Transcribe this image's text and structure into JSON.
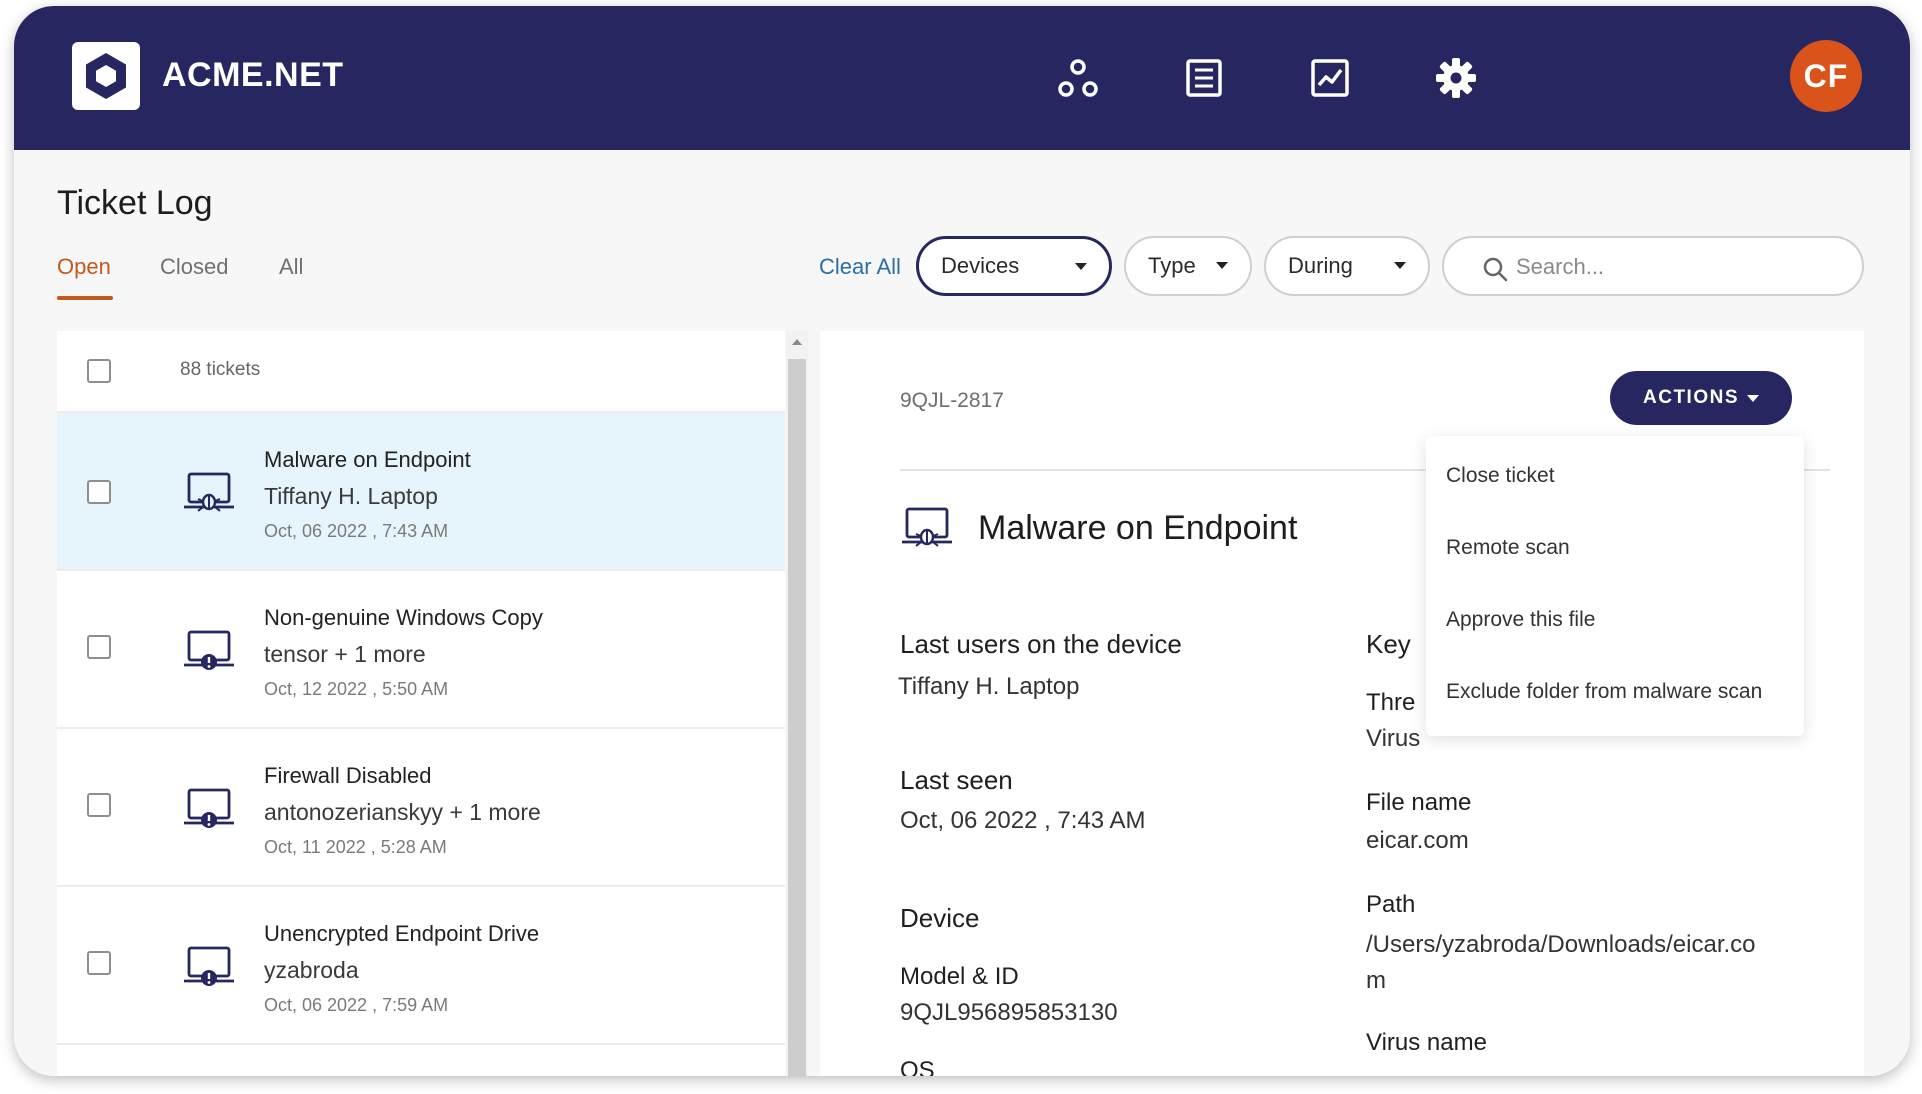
{
  "header": {
    "brand": "ACME.NET",
    "avatar_initials": "CF",
    "icons": [
      "network-icon",
      "list-icon",
      "chart-icon",
      "gear-icon"
    ]
  },
  "page": {
    "title": "Ticket Log",
    "tabs": [
      {
        "label": "Open",
        "active": true
      },
      {
        "label": "Closed",
        "active": false
      },
      {
        "label": "All",
        "active": false
      }
    ]
  },
  "filters": {
    "clear_all": "Clear All",
    "devices": "Devices",
    "type": "Type",
    "during": "During",
    "search_placeholder": "Search..."
  },
  "list": {
    "count": "88 tickets",
    "tickets": [
      {
        "title": "Malware on Endpoint",
        "subtitle": "Tiffany H. Laptop",
        "date": "Oct, 06 2022 , 7:43 AM",
        "icon": "malware-laptop-icon",
        "selected": true
      },
      {
        "title": "Non-genuine Windows Copy",
        "subtitle": "tensor + 1 more",
        "date": "Oct, 12 2022 , 5:50 AM",
        "icon": "warning-laptop-icon",
        "selected": false
      },
      {
        "title": "Firewall Disabled",
        "subtitle": "antonozerianskyy + 1 more",
        "date": "Oct, 11 2022 , 5:28 AM",
        "icon": "warning-laptop-icon",
        "selected": false
      },
      {
        "title": "Unencrypted Endpoint Drive",
        "subtitle": "yzabroda",
        "date": "Oct, 06 2022 , 7:59 AM",
        "icon": "warning-laptop-icon",
        "selected": false
      }
    ]
  },
  "detail": {
    "id": "9QJL-2817",
    "actions_label": "ACTIONS",
    "title": "Malware on Endpoint",
    "last_users_label": "Last users on the device",
    "last_users_value": "Tiffany H. Laptop",
    "last_seen_label": "Last seen",
    "last_seen_value": "Oct, 06 2022 , 7:43 AM",
    "device_label": "Device",
    "model_label": "Model & ID",
    "model_value": "9QJL956895853130",
    "os_label": "OS",
    "key_label": "Key",
    "threat_label": "Thre",
    "threat_value": "Virus",
    "file_name_label": "File name",
    "file_name_value": "eicar.com",
    "path_label": "Path",
    "path_value_line1": "/Users/yzabroda/Downloads/eicar.co",
    "path_value_line2": "m",
    "virus_name_label": "Virus name"
  },
  "actions_menu": {
    "items": [
      "Close ticket",
      "Remote scan",
      "Approve this file",
      "Exclude folder from malware scan"
    ]
  },
  "colors": {
    "header_bg": "#262760",
    "accent": "#c25a1c",
    "avatar": "#d9531b",
    "selected_row": "#e6f4fb",
    "link": "#2a6fa6"
  }
}
